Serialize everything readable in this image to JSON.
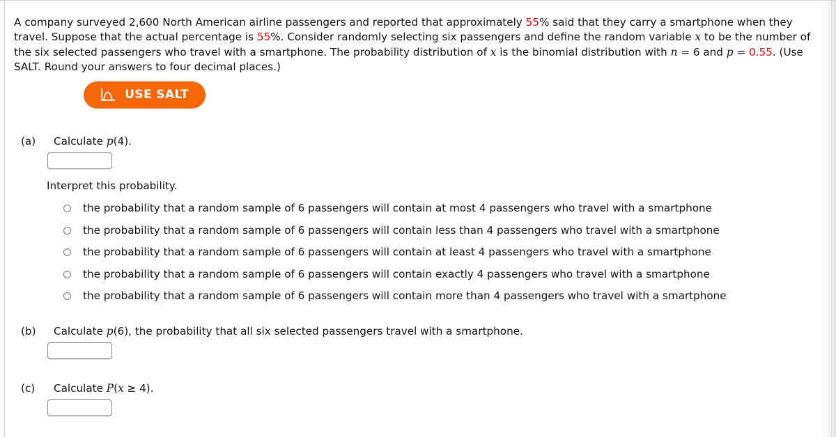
{
  "problem": {
    "intro_segments": [
      {
        "t": "A company surveyed 2,600 North American airline passengers and reported that approximately ",
        "style": "normal"
      },
      {
        "t": "55",
        "style": "red"
      },
      {
        "t": "% said that they carry a smartphone when they travel. Suppose that the actual percentage is ",
        "style": "normal"
      },
      {
        "t": "55",
        "style": "red"
      },
      {
        "t": "%. Consider randomly selecting six passengers and define the random variable ",
        "style": "normal"
      },
      {
        "t": "x",
        "style": "math"
      },
      {
        "t": " to be the number of the six selected passengers who travel with a smartphone. The probability distribution of ",
        "style": "normal"
      },
      {
        "t": "x",
        "style": "math"
      },
      {
        "t": " is the binomial distribution with ",
        "style": "normal"
      },
      {
        "t": "n",
        "style": "math"
      },
      {
        "t": " = 6 and ",
        "style": "normal"
      },
      {
        "t": "p",
        "style": "math"
      },
      {
        "t": " = ",
        "style": "normal"
      },
      {
        "t": "0.55",
        "style": "red"
      },
      {
        "t": ". (Use SALT. Round your answers to four decimal places.)",
        "style": "normal"
      }
    ],
    "survey_size": "2,600",
    "reported_percentage": "55",
    "actual_percentage": "55",
    "n_value": "6",
    "p_value": "0.55",
    "rounding_instruction": "Round your answers to four decimal places."
  },
  "salt_button": {
    "label": "USE SALT",
    "icon": "bell-curve-icon",
    "background_color": "#f4670b",
    "text_color": "#ffffff"
  },
  "parts": {
    "a": {
      "label": "(a)",
      "prompt_prefix": "Calculate ",
      "prompt_var": "p",
      "prompt_suffix": "(4).",
      "answer_value": "",
      "answer_placeholder": ""
    },
    "b": {
      "label": "(b)",
      "prompt_prefix": "Calculate ",
      "prompt_var": "p",
      "prompt_suffix": "(6), the probability that all six selected passengers travel with a smartphone.",
      "answer_value": "",
      "answer_placeholder": ""
    },
    "c": {
      "label": "(c)",
      "prompt_prefix": "Calculate ",
      "prompt_var": "P",
      "prompt_var2": "x",
      "prompt_suffix": " ≥ 4).",
      "prompt_open_paren": "(",
      "answer_value": "",
      "answer_placeholder": ""
    }
  },
  "interpret": {
    "heading": "Interpret this probability.",
    "options": [
      {
        "label": "the probability that a random sample of 6 passengers will contain at most 4 passengers who travel with a smartphone",
        "selected": false
      },
      {
        "label": "the probability that a random sample of 6 passengers will contain less than 4 passengers who travel with a smartphone",
        "selected": false
      },
      {
        "label": "the probability that a random sample of 6 passengers will contain at least 4 passengers who travel with a smartphone",
        "selected": false
      },
      {
        "label": "the probability that a random sample of 6 passengers will contain exactly 4 passengers who travel with a smartphone",
        "selected": false
      },
      {
        "label": "the probability that a random sample of 6 passengers will contain more than 4 passengers who travel with a smartphone",
        "selected": false
      }
    ]
  },
  "colors": {
    "highlight_red": "#e8060d",
    "salt_orange": "#f4670b",
    "text": "#141414",
    "border_gray": "#8b8b8b"
  }
}
